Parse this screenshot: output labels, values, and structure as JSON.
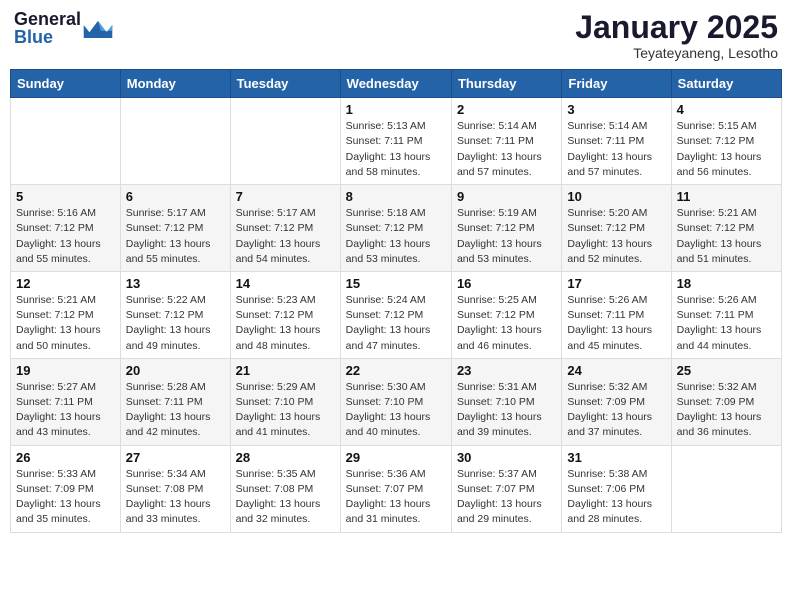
{
  "header": {
    "logo_general": "General",
    "logo_blue": "Blue",
    "month_title": "January 2025",
    "location": "Teyateyaneng, Lesotho"
  },
  "weekdays": [
    "Sunday",
    "Monday",
    "Tuesday",
    "Wednesday",
    "Thursday",
    "Friday",
    "Saturday"
  ],
  "weeks": [
    [
      {
        "day": "",
        "info": ""
      },
      {
        "day": "",
        "info": ""
      },
      {
        "day": "",
        "info": ""
      },
      {
        "day": "1",
        "info": "Sunrise: 5:13 AM\nSunset: 7:11 PM\nDaylight: 13 hours\nand 58 minutes."
      },
      {
        "day": "2",
        "info": "Sunrise: 5:14 AM\nSunset: 7:11 PM\nDaylight: 13 hours\nand 57 minutes."
      },
      {
        "day": "3",
        "info": "Sunrise: 5:14 AM\nSunset: 7:11 PM\nDaylight: 13 hours\nand 57 minutes."
      },
      {
        "day": "4",
        "info": "Sunrise: 5:15 AM\nSunset: 7:12 PM\nDaylight: 13 hours\nand 56 minutes."
      }
    ],
    [
      {
        "day": "5",
        "info": "Sunrise: 5:16 AM\nSunset: 7:12 PM\nDaylight: 13 hours\nand 55 minutes."
      },
      {
        "day": "6",
        "info": "Sunrise: 5:17 AM\nSunset: 7:12 PM\nDaylight: 13 hours\nand 55 minutes."
      },
      {
        "day": "7",
        "info": "Sunrise: 5:17 AM\nSunset: 7:12 PM\nDaylight: 13 hours\nand 54 minutes."
      },
      {
        "day": "8",
        "info": "Sunrise: 5:18 AM\nSunset: 7:12 PM\nDaylight: 13 hours\nand 53 minutes."
      },
      {
        "day": "9",
        "info": "Sunrise: 5:19 AM\nSunset: 7:12 PM\nDaylight: 13 hours\nand 53 minutes."
      },
      {
        "day": "10",
        "info": "Sunrise: 5:20 AM\nSunset: 7:12 PM\nDaylight: 13 hours\nand 52 minutes."
      },
      {
        "day": "11",
        "info": "Sunrise: 5:21 AM\nSunset: 7:12 PM\nDaylight: 13 hours\nand 51 minutes."
      }
    ],
    [
      {
        "day": "12",
        "info": "Sunrise: 5:21 AM\nSunset: 7:12 PM\nDaylight: 13 hours\nand 50 minutes."
      },
      {
        "day": "13",
        "info": "Sunrise: 5:22 AM\nSunset: 7:12 PM\nDaylight: 13 hours\nand 49 minutes."
      },
      {
        "day": "14",
        "info": "Sunrise: 5:23 AM\nSunset: 7:12 PM\nDaylight: 13 hours\nand 48 minutes."
      },
      {
        "day": "15",
        "info": "Sunrise: 5:24 AM\nSunset: 7:12 PM\nDaylight: 13 hours\nand 47 minutes."
      },
      {
        "day": "16",
        "info": "Sunrise: 5:25 AM\nSunset: 7:12 PM\nDaylight: 13 hours\nand 46 minutes."
      },
      {
        "day": "17",
        "info": "Sunrise: 5:26 AM\nSunset: 7:11 PM\nDaylight: 13 hours\nand 45 minutes."
      },
      {
        "day": "18",
        "info": "Sunrise: 5:26 AM\nSunset: 7:11 PM\nDaylight: 13 hours\nand 44 minutes."
      }
    ],
    [
      {
        "day": "19",
        "info": "Sunrise: 5:27 AM\nSunset: 7:11 PM\nDaylight: 13 hours\nand 43 minutes."
      },
      {
        "day": "20",
        "info": "Sunrise: 5:28 AM\nSunset: 7:11 PM\nDaylight: 13 hours\nand 42 minutes."
      },
      {
        "day": "21",
        "info": "Sunrise: 5:29 AM\nSunset: 7:10 PM\nDaylight: 13 hours\nand 41 minutes."
      },
      {
        "day": "22",
        "info": "Sunrise: 5:30 AM\nSunset: 7:10 PM\nDaylight: 13 hours\nand 40 minutes."
      },
      {
        "day": "23",
        "info": "Sunrise: 5:31 AM\nSunset: 7:10 PM\nDaylight: 13 hours\nand 39 minutes."
      },
      {
        "day": "24",
        "info": "Sunrise: 5:32 AM\nSunset: 7:09 PM\nDaylight: 13 hours\nand 37 minutes."
      },
      {
        "day": "25",
        "info": "Sunrise: 5:32 AM\nSunset: 7:09 PM\nDaylight: 13 hours\nand 36 minutes."
      }
    ],
    [
      {
        "day": "26",
        "info": "Sunrise: 5:33 AM\nSunset: 7:09 PM\nDaylight: 13 hours\nand 35 minutes."
      },
      {
        "day": "27",
        "info": "Sunrise: 5:34 AM\nSunset: 7:08 PM\nDaylight: 13 hours\nand 33 minutes."
      },
      {
        "day": "28",
        "info": "Sunrise: 5:35 AM\nSunset: 7:08 PM\nDaylight: 13 hours\nand 32 minutes."
      },
      {
        "day": "29",
        "info": "Sunrise: 5:36 AM\nSunset: 7:07 PM\nDaylight: 13 hours\nand 31 minutes."
      },
      {
        "day": "30",
        "info": "Sunrise: 5:37 AM\nSunset: 7:07 PM\nDaylight: 13 hours\nand 29 minutes."
      },
      {
        "day": "31",
        "info": "Sunrise: 5:38 AM\nSunset: 7:06 PM\nDaylight: 13 hours\nand 28 minutes."
      },
      {
        "day": "",
        "info": ""
      }
    ]
  ]
}
